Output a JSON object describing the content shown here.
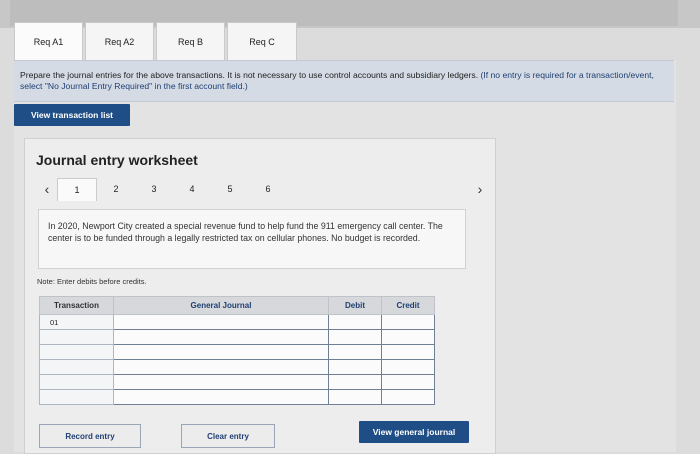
{
  "tabs": [
    "Req A1",
    "Req A2",
    "Req B",
    "Req C"
  ],
  "instructions": {
    "main": "Prepare the journal entries for the above transactions. It is not necessary to use control accounts and subsidiary ledgers.",
    "hint": "(If no entry is required for a transaction/event, select \"No Journal Entry Required\" in the first account field.)"
  },
  "view_transaction_list_label": "View transaction list",
  "worksheet": {
    "title": "Journal entry worksheet",
    "pages": [
      "1",
      "2",
      "3",
      "4",
      "5",
      "6"
    ],
    "description": "In 2020, Newport City created a special revenue fund to help fund the 911 emergency call center. The center is to be funded through a legally restricted tax on cellular phones. No budget is recorded.",
    "note": "Note: Enter debits before credits.",
    "columns": [
      "Transaction",
      "General Journal",
      "Debit",
      "Credit"
    ],
    "transaction_number": "01",
    "record_entry_label": "Record entry",
    "clear_entry_label": "Clear entry",
    "view_general_journal_label": "View general journal"
  },
  "colors": {
    "primary_button": "#1f4e86",
    "instruction_bg": "#d4dbe5"
  },
  "icons": {
    "prev": "chevron-left-icon",
    "next": "chevron-right-icon"
  }
}
